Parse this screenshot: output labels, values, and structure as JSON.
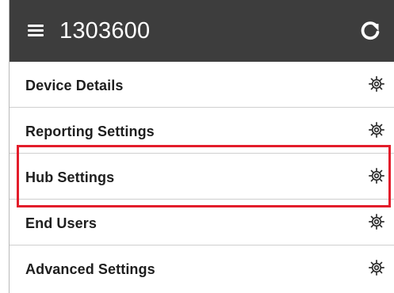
{
  "header": {
    "title": "1303600",
    "menu_icon": "hamburger-menu-icon",
    "refresh_icon": "refresh-icon"
  },
  "rows": [
    {
      "label": "Device Details",
      "icon": "gear-icon"
    },
    {
      "label": "Reporting Settings",
      "icon": "gear-icon"
    },
    {
      "label": "Hub Settings",
      "icon": "gear-icon"
    },
    {
      "label": "End Users",
      "icon": "gear-icon"
    },
    {
      "label": "Advanced Settings",
      "icon": "gear-icon"
    }
  ],
  "colors": {
    "header_bg": "#3d3d3d",
    "highlight": "#e31d2b",
    "text": "#1e1e1e"
  }
}
